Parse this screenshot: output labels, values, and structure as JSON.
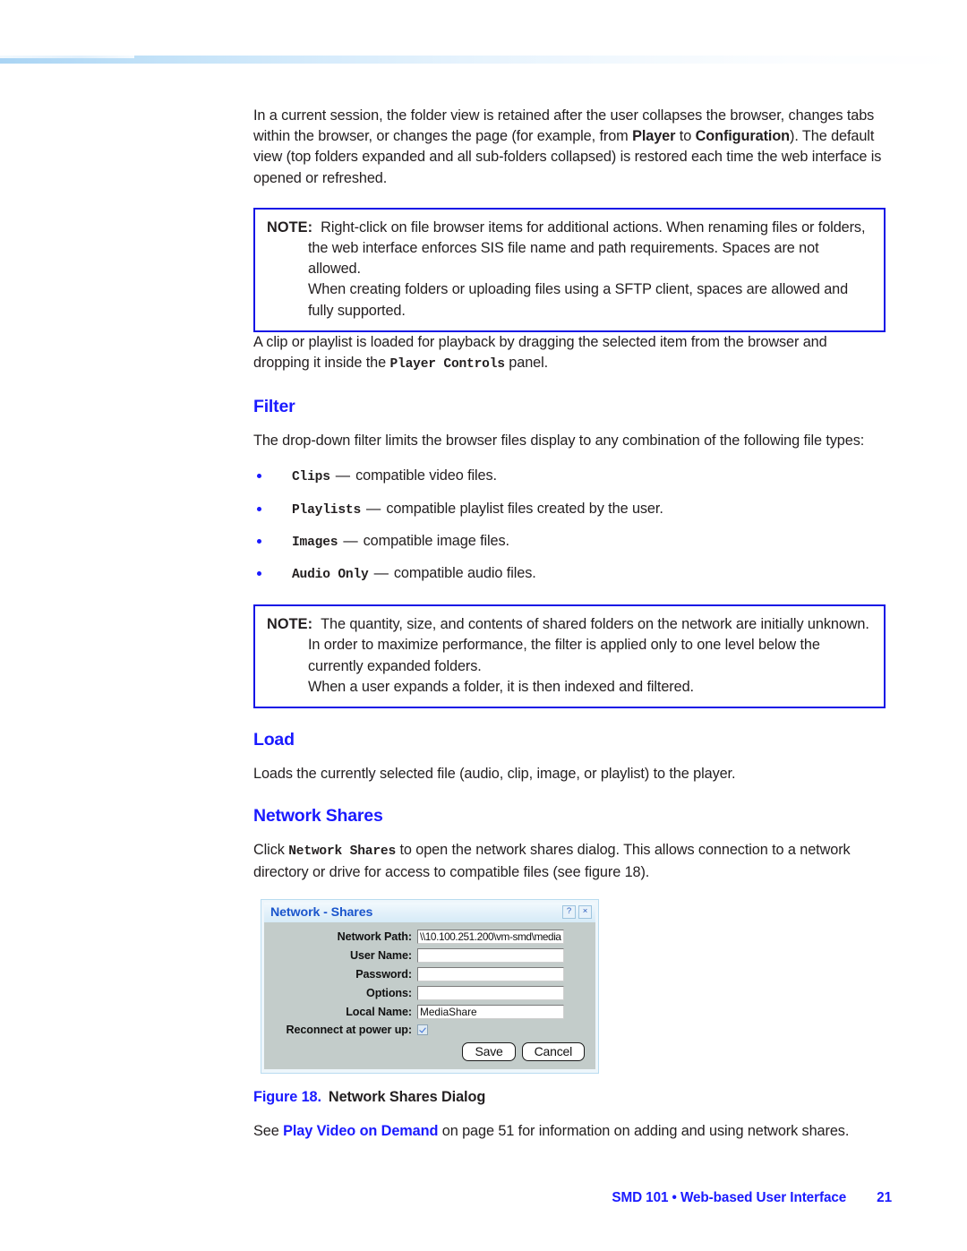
{
  "page": {
    "intro": {
      "line_a": "In a current session, the folder view is retained after the user collapses the browser, changes tabs within the browser, or changes the page (for example, from ",
      "bold_player": "Player",
      "mid": " to ",
      "bold_config": "Configuration",
      "line_b": "). The default view (top folders expanded and all sub-folders collapsed) is restored each time the web interface is opened or refreshed."
    },
    "note1": {
      "label": "NOTE:",
      "paragraph1": "Right-click on file browser items for additional actions. When renaming files or folders, the web interface enforces SIS file name and path requirements. Spaces are not allowed.",
      "paragraph2": "When creating folders or uploading files using a SFTP client, spaces are allowed and fully supported."
    },
    "drag_para": {
      "before": "A clip or playlist is loaded for playback by dragging the selected item from the browser and dropping it inside the ",
      "mono": "Player Controls",
      "after": " panel."
    },
    "filter": {
      "heading": "Filter",
      "intro": "The drop-down filter limits the browser files display to any combination of the following file types:",
      "items": [
        {
          "term": "Clips",
          "dash": "—",
          "desc": "compatible video files."
        },
        {
          "term": "Playlists",
          "dash": "—",
          "desc": "compatible playlist files created by the user."
        },
        {
          "term": "Images",
          "dash": "—",
          "desc": "compatible image files."
        },
        {
          "term": "Audio Only",
          "dash": "—",
          "desc": "compatible audio files."
        }
      ]
    },
    "note2": {
      "label": "NOTE:",
      "paragraph1": "The quantity, size, and contents of shared folders on the network are initially unknown. In order to maximize performance, the filter is applied only to one level below the currently expanded folders.",
      "paragraph2": "When a user expands a folder, it is then indexed and filtered."
    },
    "load": {
      "heading": "Load",
      "body": "Loads the currently selected file (audio, clip, image, or playlist) to the player."
    },
    "network_shares": {
      "heading": "Network Shares",
      "before": "Click ",
      "mono": "Network Shares",
      "after": " to open the network shares dialog. This allows connection to a network directory or drive for access to compatible files (see figure 18)."
    },
    "dialog": {
      "title": "Network - Shares",
      "help_icon": "?",
      "close_icon": "×",
      "fields": [
        {
          "label": "Network Path:",
          "value": "\\\\10.100.251.200\\vm-smd\\media"
        },
        {
          "label": "User Name:",
          "value": ""
        },
        {
          "label": "Password:",
          "value": ""
        },
        {
          "label": "Options:",
          "value": ""
        },
        {
          "label": "Local Name:",
          "value": "MediaShare"
        }
      ],
      "checkbox_label": "Reconnect at power up:",
      "checkbox_checked": true,
      "save_label": "Save",
      "cancel_label": "Cancel"
    },
    "figure_caption": {
      "number": "Figure 18.",
      "title": "Network Shares Dialog"
    },
    "see_also": {
      "before": "See ",
      "link": "Play Video on Demand",
      "after": " on page 51 for information on adding and using network shares."
    },
    "footer": {
      "text": "SMD 101 • Web-based User Interface",
      "page_number": "21"
    },
    "colors": {
      "heading_blue": "#1a1aff",
      "note_border": "#1414e6",
      "dialog_title_blue": "#1a55cc",
      "dialog_body_gray": "#c3ccca"
    }
  }
}
